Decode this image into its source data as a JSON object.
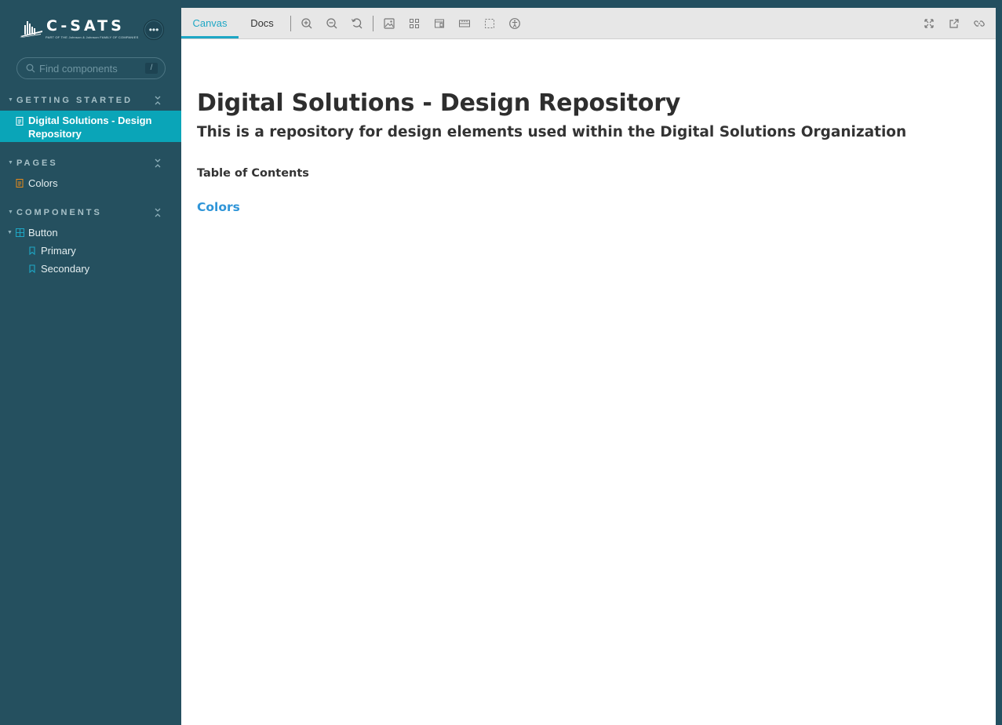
{
  "brand": {
    "name": "C-SATS",
    "tagline": "PART OF THE Johnson & Johnson FAMILY OF COMPANIES"
  },
  "sidebar": {
    "search": {
      "placeholder": "Find components",
      "shortcut": "/"
    },
    "sections": [
      {
        "title": "GETTING STARTED",
        "items": [
          {
            "label": "Digital Solutions - Design Repository",
            "icon": "document-icon",
            "active": true
          }
        ]
      },
      {
        "title": "PAGES",
        "items": [
          {
            "label": "Colors",
            "icon": "document-icon",
            "active": false
          }
        ]
      },
      {
        "title": "COMPONENTS",
        "items": [
          {
            "label": "Button",
            "icon": "component-icon",
            "expanded": true
          },
          {
            "label": "Primary",
            "icon": "bookmark-icon"
          },
          {
            "label": "Secondary",
            "icon": "bookmark-icon"
          }
        ]
      }
    ]
  },
  "toolbar": {
    "tabs": [
      "Canvas",
      "Docs"
    ],
    "active_tab": "Canvas",
    "tools": [
      "zoom-in-icon",
      "zoom-out-icon",
      "zoom-reset-icon",
      "background-icon",
      "grid-icon",
      "viewport-icon",
      "measure-icon",
      "outline-icon",
      "accessibility-icon"
    ],
    "right_tools": [
      "fullscreen-icon",
      "open-new-tab-icon",
      "copy-link-icon"
    ]
  },
  "doc": {
    "title": "Digital Solutions - Design Repository",
    "subtitle": "This is a repository for design elements used within the Digital Solutions Organization",
    "toc_heading": "Table of Contents",
    "toc_links": [
      "Colors"
    ]
  },
  "colors": {
    "sidebar_bg": "#25505f",
    "active_item": "#0aa5b8",
    "accent": "#1ea7c5",
    "link": "#2f95d8"
  }
}
